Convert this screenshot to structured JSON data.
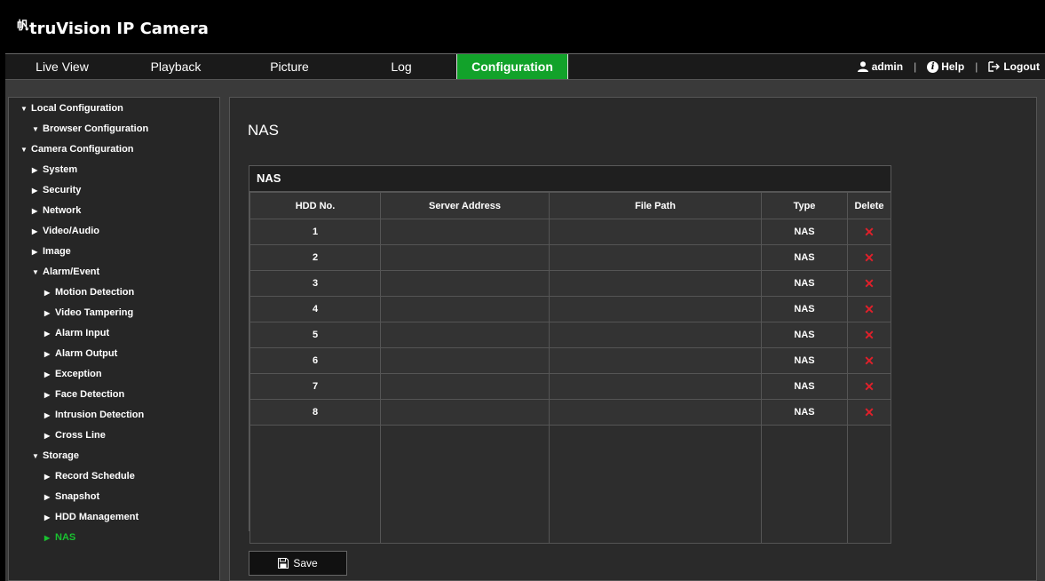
{
  "app": {
    "logo_mark": "帆",
    "title": "truVision IP Camera"
  },
  "nav": {
    "tabs": [
      {
        "label": "Live View"
      },
      {
        "label": "Playback"
      },
      {
        "label": "Picture"
      },
      {
        "label": "Log"
      },
      {
        "label": "Configuration"
      }
    ],
    "active_tab": "Configuration",
    "user_label": "admin",
    "help_label": "Help",
    "logout_label": "Logout",
    "separator": "|"
  },
  "sidebar": {
    "items": [
      {
        "label": "Local Configuration",
        "arrow": "▼"
      },
      {
        "label": "Browser Configuration",
        "arrow": "▼"
      },
      {
        "label": "Camera Configuration",
        "arrow": "▼"
      },
      {
        "label": "System",
        "arrow": "▶"
      },
      {
        "label": "Security",
        "arrow": "▶"
      },
      {
        "label": "Network",
        "arrow": "▶"
      },
      {
        "label": "Video/Audio",
        "arrow": "▶"
      },
      {
        "label": "Image",
        "arrow": "▶"
      },
      {
        "label": "Alarm/Event",
        "arrow": "▼"
      },
      {
        "label": "Motion Detection",
        "arrow": "▶"
      },
      {
        "label": "Video Tampering",
        "arrow": "▶"
      },
      {
        "label": "Alarm Input",
        "arrow": "▶"
      },
      {
        "label": "Alarm Output",
        "arrow": "▶"
      },
      {
        "label": "Exception",
        "arrow": "▶"
      },
      {
        "label": "Face Detection",
        "arrow": "▶"
      },
      {
        "label": "Intrusion Detection",
        "arrow": "▶"
      },
      {
        "label": "Cross Line",
        "arrow": "▶"
      },
      {
        "label": "Storage",
        "arrow": "▼"
      },
      {
        "label": "Record Schedule",
        "arrow": "▶"
      },
      {
        "label": "Snapshot",
        "arrow": "▶"
      },
      {
        "label": "HDD Management",
        "arrow": "▶"
      },
      {
        "label": "NAS",
        "arrow": "▶"
      }
    ],
    "active_item": "NAS",
    "active_color": "#19c230"
  },
  "main": {
    "page_title": "NAS",
    "box_title": "NAS",
    "columns": [
      "HDD No.",
      "Server Address",
      "File Path",
      "Type",
      "Delete"
    ],
    "rows": [
      {
        "hdd": "1",
        "server": "",
        "path": "",
        "type": "NAS"
      },
      {
        "hdd": "2",
        "server": "",
        "path": "",
        "type": "NAS"
      },
      {
        "hdd": "3",
        "server": "",
        "path": "",
        "type": "NAS"
      },
      {
        "hdd": "4",
        "server": "",
        "path": "",
        "type": "NAS"
      },
      {
        "hdd": "5",
        "server": "",
        "path": "",
        "type": "NAS"
      },
      {
        "hdd": "6",
        "server": "",
        "path": "",
        "type": "NAS"
      },
      {
        "hdd": "7",
        "server": "",
        "path": "",
        "type": "NAS"
      },
      {
        "hdd": "8",
        "server": "",
        "path": "",
        "type": "NAS"
      }
    ],
    "delete_glyph": "✕",
    "save_label": "Save"
  },
  "colors": {
    "accent_green": "#12a22a",
    "delete_red": "#e0202a"
  }
}
